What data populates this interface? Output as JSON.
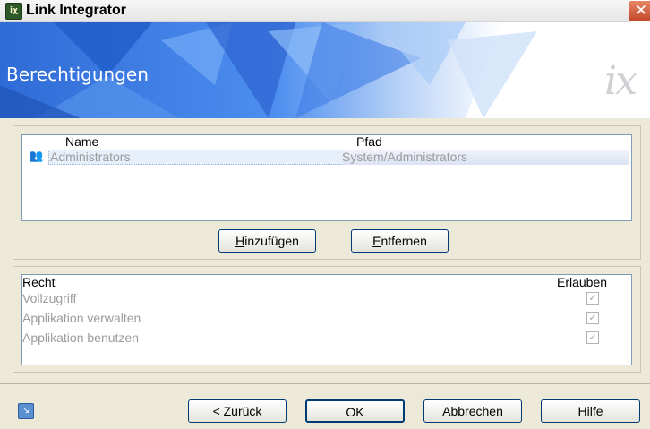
{
  "window": {
    "title": "Link Integrator",
    "app_icon": "app-icon",
    "close_glyph": "✕"
  },
  "banner": {
    "title": "Berechtigungen",
    "logo_text": "ix"
  },
  "members": {
    "columns": [
      "Name",
      "Pfad"
    ],
    "rows": [
      {
        "icon": "users-group-icon",
        "name": "Administrators",
        "path": "System/Administrators"
      }
    ],
    "add_button": {
      "prefix": "",
      "mnemonic": "H",
      "rest": "inzufügen"
    },
    "remove_button": {
      "prefix": "",
      "mnemonic": "E",
      "rest": "ntfernen"
    }
  },
  "rights": {
    "columns": [
      "Recht",
      "Erlauben"
    ],
    "rows": [
      {
        "label": "Vollzugriff",
        "allowed": true
      },
      {
        "label": "Applikation verwalten",
        "allowed": true
      },
      {
        "label": "Applikation benutzen",
        "allowed": true
      }
    ]
  },
  "footer": {
    "back_label": "< Zurück",
    "ok_label": "OK",
    "cancel_label": "Abbrechen",
    "help_label": "Hilfe"
  },
  "colors": {
    "banner_blue": "#3b74e4",
    "accent_border": "#003c74"
  }
}
